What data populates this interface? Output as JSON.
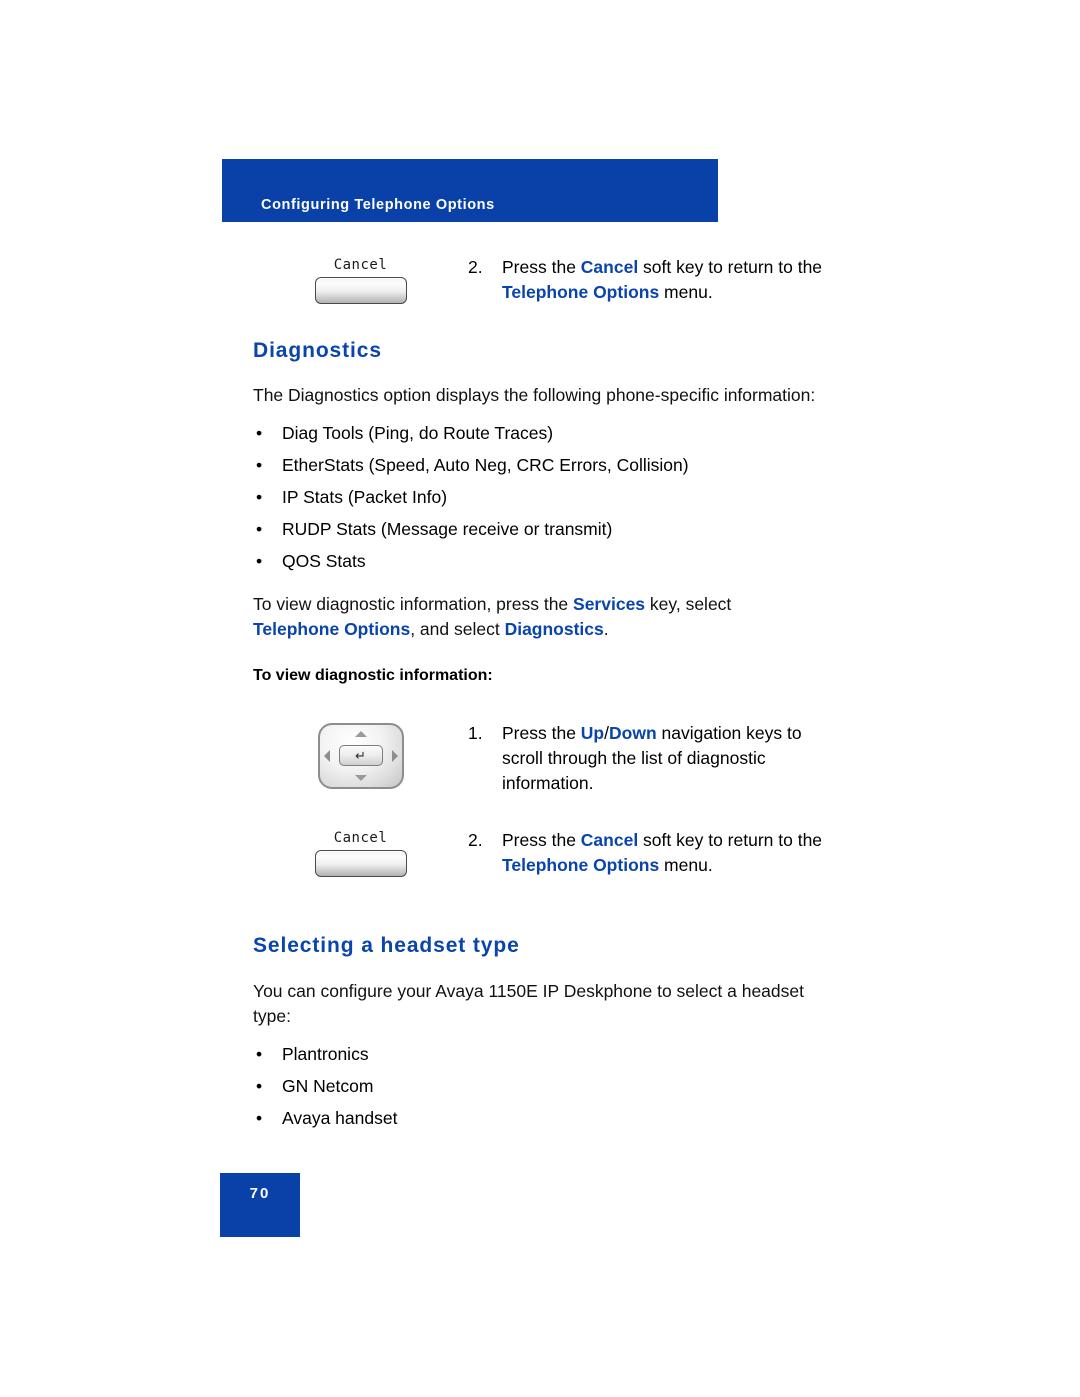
{
  "header": {
    "title": "Configuring Telephone Options"
  },
  "steps_top": [
    {
      "graphic": "cancel-softkey",
      "softkey_label": "Cancel",
      "number": "2.",
      "text_parts": [
        {
          "text": "Press the ",
          "style": "normal"
        },
        {
          "text": "Cancel",
          "style": "blue"
        },
        {
          "text": " soft key to return to the ",
          "style": "normal"
        },
        {
          "text": "Telephone Options",
          "style": "blue"
        },
        {
          "text": " menu.",
          "style": "normal"
        }
      ]
    }
  ],
  "diagnostics": {
    "heading": "Diagnostics",
    "intro": "The Diagnostics option displays the following phone-specific information:",
    "bullets": [
      "Diag Tools (Ping, do Route Traces)",
      "EtherStats (Speed, Auto Neg, CRC Errors, Collision)",
      "IP Stats (Packet Info)",
      "RUDP Stats (Message receive or transmit)",
      "QOS Stats"
    ],
    "bullet_marker": "•",
    "howto_parts": [
      {
        "text": "To view diagnostic information, press the ",
        "style": "normal"
      },
      {
        "text": "Services",
        "style": "blue"
      },
      {
        "text": " key, select ",
        "style": "normal"
      },
      {
        "text": "Telephone Options",
        "style": "blue"
      },
      {
        "text": ", and select ",
        "style": "normal"
      },
      {
        "text": "Diagnostics",
        "style": "blue"
      },
      {
        "text": ".",
        "style": "normal"
      }
    ],
    "subhead": "To view diagnostic information:",
    "steps": [
      {
        "graphic": "navigation-cluster",
        "number": "1.",
        "text_parts": [
          {
            "text": "Press the ",
            "style": "normal"
          },
          {
            "text": "Up",
            "style": "blue"
          },
          {
            "text": "/",
            "style": "normal"
          },
          {
            "text": "Down",
            "style": "blue"
          },
          {
            "text": " navigation keys to scroll through the list of diagnostic information.",
            "style": "normal"
          }
        ]
      },
      {
        "graphic": "cancel-softkey",
        "softkey_label": "Cancel",
        "number": "2.",
        "text_parts": [
          {
            "text": "Press the ",
            "style": "normal"
          },
          {
            "text": "Cancel",
            "style": "blue"
          },
          {
            "text": " soft key to return to the ",
            "style": "normal"
          },
          {
            "text": "Telephone Options",
            "style": "blue"
          },
          {
            "text": " menu.",
            "style": "normal"
          }
        ]
      }
    ]
  },
  "headset": {
    "heading": "Selecting a headset type",
    "intro": "You can configure your Avaya 1150E IP Deskphone to select a headset type:",
    "bullets": [
      "Plantronics",
      "GN Netcom",
      "Avaya handset"
    ],
    "bullet_marker": "•"
  },
  "footer": {
    "page_number": "70"
  },
  "icons": {
    "enter_key": "↵"
  },
  "colors": {
    "brand_blue": "#0a41a8",
    "heading_blue": "#0a44ad",
    "banner_text": "#ffffff"
  }
}
